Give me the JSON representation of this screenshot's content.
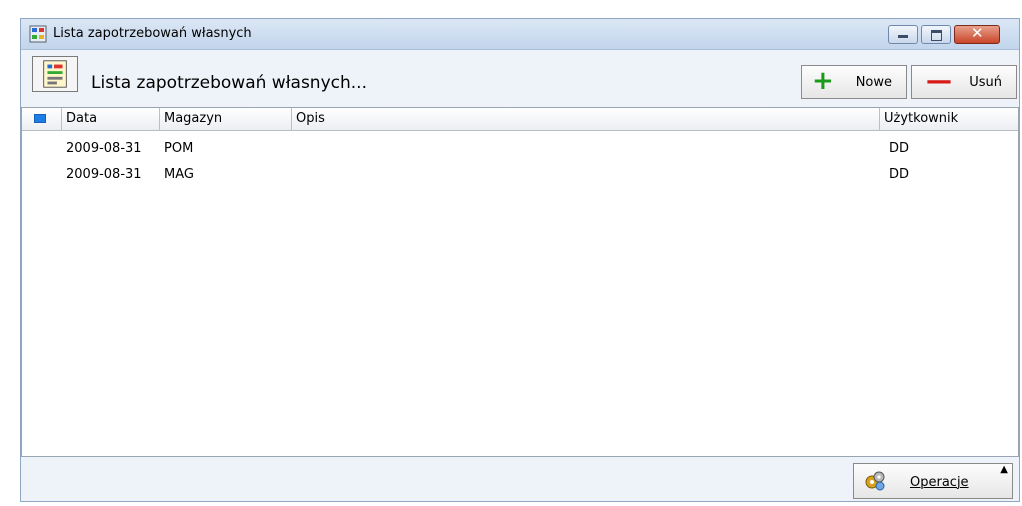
{
  "window": {
    "title": "Lista zapotrzebowań własnych",
    "controls": {
      "minimize": "minimize",
      "maximize": "maximize",
      "close": "✕"
    }
  },
  "toolbar": {
    "title": "Lista zapotrzebowań własnych...",
    "new_label": "Nowe",
    "delete_label": "Usuń",
    "new_symbol": "+",
    "delete_symbol": "—"
  },
  "grid": {
    "columns": [
      "Data",
      "Magazyn",
      "Opis",
      "Użytkownik"
    ],
    "rows": [
      {
        "data": "2009-08-31",
        "magazyn": "POM",
        "opis": "",
        "uzytkownik": "DD"
      },
      {
        "data": "2009-08-31",
        "magazyn": "MAG",
        "opis": "",
        "uzytkownik": "DD"
      }
    ]
  },
  "footer": {
    "operations_label": "Operacje",
    "caret": "▲"
  },
  "colors": {
    "accent": "#1e7ee8",
    "add": "#1a9a1a",
    "remove": "#d61a1a",
    "close_button": "#c8452a"
  },
  "icons": [
    "app-list-icon",
    "minimize-icon",
    "maximize-icon",
    "close-icon",
    "list-document-icon",
    "plus-icon",
    "minus-icon",
    "gears-icon",
    "caret-up-icon"
  ]
}
